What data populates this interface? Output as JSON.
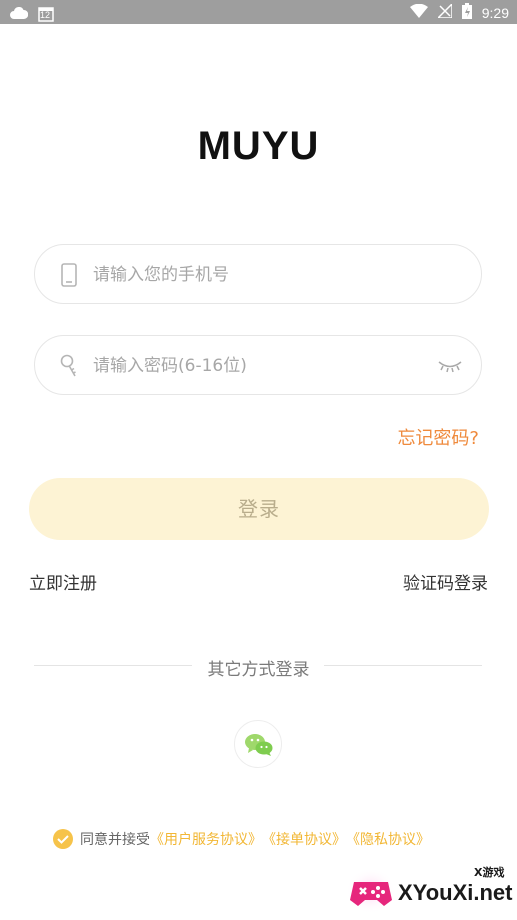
{
  "status_bar": {
    "time": "9:29",
    "calendar_day": "12"
  },
  "app": {
    "title": "MUYU"
  },
  "form": {
    "phone_placeholder": "请输入您的手机号",
    "password_placeholder": "请输入密码(6-16位)",
    "forgot_password": "忘记密码?",
    "login_button": "登录",
    "register": "立即注册",
    "code_login": "验证码登录"
  },
  "other_login": {
    "label": "其它方式登录",
    "wechat_icon": "wechat-icon"
  },
  "agreement": {
    "prefix": "同意并接受",
    "user_agreement": "《用户服务协议》",
    "order_agreement": "《接单协议》",
    "privacy_agreement": "《隐私协议》"
  },
  "watermark": {
    "brand": "XYouXi.net",
    "small": "X游戏"
  },
  "colors": {
    "accent": "#ef8a3c",
    "button_bg": "#fdf3d4",
    "agreement_link": "#f2b735",
    "status_bar": "#9e9e9e"
  }
}
